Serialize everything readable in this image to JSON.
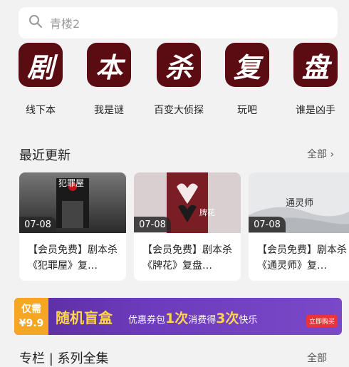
{
  "search": {
    "query": "青楼2"
  },
  "categories": [
    {
      "glyph": "剧",
      "label": "线下本"
    },
    {
      "glyph": "本",
      "label": "我是谜"
    },
    {
      "glyph": "杀",
      "label": "百变大侦探"
    },
    {
      "glyph": "复",
      "label": "玩吧"
    },
    {
      "glyph": "盘",
      "label": "谁是凶手"
    }
  ],
  "recent": {
    "title": "最近更新",
    "more": "全部",
    "cards": [
      {
        "date": "07-08",
        "title": "【会员免费】剧本杀《犯罪屋》复…",
        "cover_text": "犯罪屋"
      },
      {
        "date": "07-08",
        "title": "【会员免费】剧本杀《牌花》复盘…",
        "cover_text": "牌花"
      },
      {
        "date": "07-08",
        "title": "【会员免费】剧本杀《通灵师》复…",
        "cover_text": "通灵师"
      }
    ]
  },
  "banner": {
    "price_label": "仅需",
    "price": "¥9.9",
    "main": "随机盲盒",
    "sub_a": "优惠券包",
    "sub_b": "1次",
    "sub_c": "消费得",
    "sub_d": "3次",
    "sub_e": "快乐",
    "buy": "立即购买"
  },
  "section2": {
    "title": "专栏 | 系列全集",
    "more": "全部"
  },
  "colors": {
    "accent": "#5b0c12",
    "banner": "#6c3bbd",
    "badge": "#f5a623"
  }
}
